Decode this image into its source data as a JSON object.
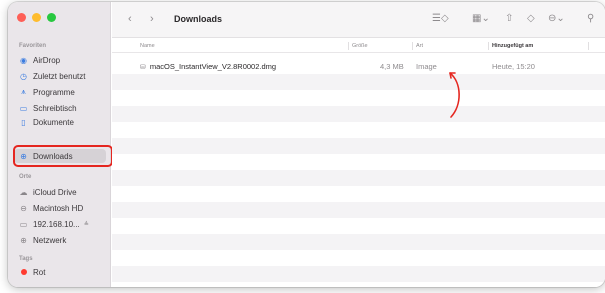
{
  "window": {
    "title": "Downloads",
    "nav_back": "‹",
    "nav_forward": "›"
  },
  "sidebar": {
    "sections": {
      "favorites": "Favoriten",
      "locations": "Orte",
      "tags": "Tags"
    },
    "favorites": [
      {
        "label": "AirDrop",
        "icon": "airdrop-icon"
      },
      {
        "label": "Zuletzt benutzt",
        "icon": "clock-icon"
      },
      {
        "label": "Programme",
        "icon": "applications-icon"
      },
      {
        "label": "Schreibtisch",
        "icon": "desktop-icon"
      },
      {
        "label": "Dokumente",
        "icon": "document-icon"
      },
      {
        "label": "Downloads",
        "icon": "downloads-icon",
        "selected": true
      }
    ],
    "locations": [
      {
        "label": "iCloud Drive",
        "icon": "cloud-icon"
      },
      {
        "label": "Macintosh HD",
        "icon": "disk-icon"
      },
      {
        "label": "192.168.10...",
        "icon": "network-share-icon",
        "eject": "≜"
      },
      {
        "label": "Netzwerk",
        "icon": "network-icon"
      }
    ],
    "tags": [
      {
        "label": "Rot",
        "color": "#ff3b30"
      }
    ]
  },
  "toolbar": {
    "list_view_icon": "list-icon",
    "grid_view_icon": "grid-icon",
    "share_icon": "share-icon",
    "tag_icon": "tag-icon",
    "action_icon": "more-icon",
    "search_icon": "search-icon"
  },
  "columns": {
    "name": "Name",
    "size": "Größe",
    "kind": "Art",
    "date_added": "Hinzugefügt am"
  },
  "files": [
    {
      "name": "macOS_InstantView_V2.8R0002.dmg",
      "size": "4,3 MB",
      "kind": "Image",
      "date_added": "Heute, 15:20"
    }
  ],
  "colors": {
    "highlight": "#e52620",
    "accent": "#3d7de0",
    "sidebar_bg": "#eae6ea"
  }
}
